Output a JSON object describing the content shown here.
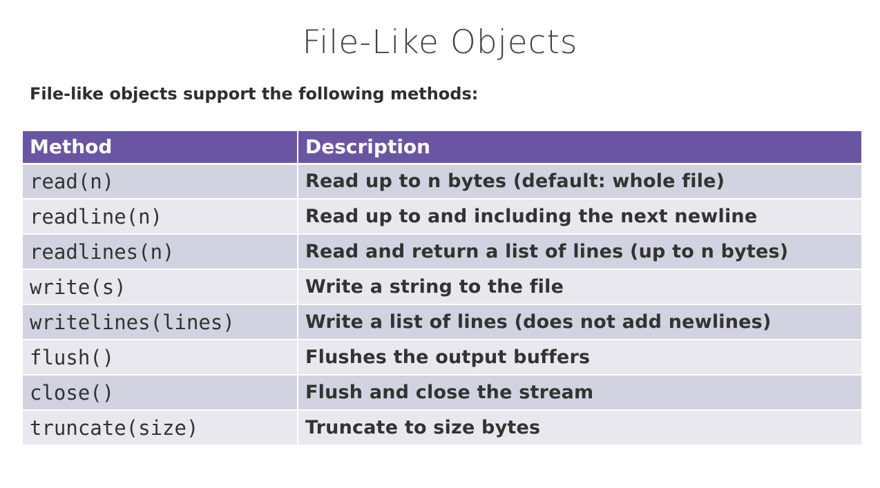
{
  "slide": {
    "title": "File-Like Objects",
    "intro": "File-like objects support the following methods:"
  },
  "table": {
    "headers": {
      "method": "Method",
      "description": "Description"
    },
    "rows": [
      {
        "method": "read(n)",
        "description": "Read up to n bytes (default: whole file)"
      },
      {
        "method": "readline(n)",
        "description": "Read up to and including the next newline"
      },
      {
        "method": "readlines(n)",
        "description": "Read and return a list of lines (up to n bytes)"
      },
      {
        "method": "write(s)",
        "description": "Write a string to the file"
      },
      {
        "method": "writelines(lines)",
        "description": "Write a list of lines (does not add newlines)"
      },
      {
        "method": "flush()",
        "description": "Flushes the output buffers"
      },
      {
        "method": "close()",
        "description": "Flush and close the stream"
      },
      {
        "method": "truncate(size)",
        "description": "Truncate to size bytes"
      }
    ]
  },
  "colors": {
    "header_background": "#6a55a4",
    "row_dark": "#d2d2e0",
    "row_light": "#e8e8ee"
  }
}
